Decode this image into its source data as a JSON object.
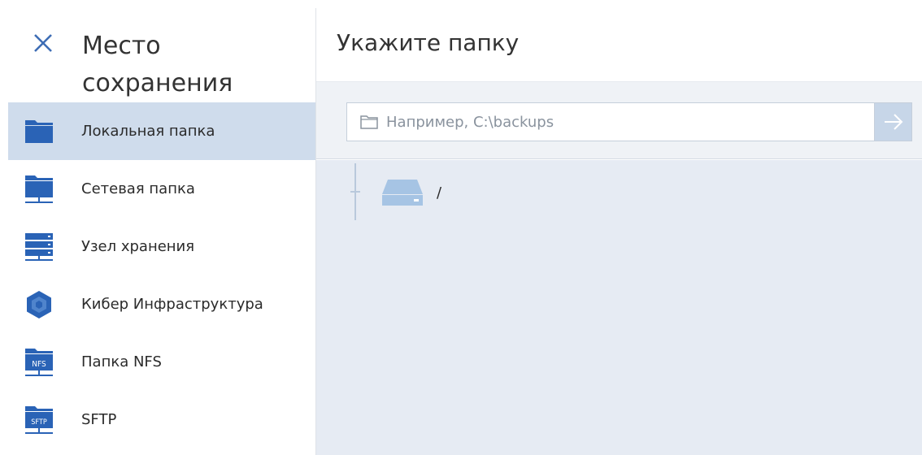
{
  "left_panel": {
    "title": "Место сохранения",
    "close_icon": "close-icon",
    "items": [
      {
        "label": "Локальная папка",
        "icon": "folder-icon",
        "active": true
      },
      {
        "label": "Сетевая папка",
        "icon": "network-folder-icon",
        "active": false
      },
      {
        "label": "Узел хранения",
        "icon": "storage-node-icon",
        "active": false
      },
      {
        "label": "Кибер Инфраструктура",
        "icon": "cyber-infrastructure-icon",
        "active": false
      },
      {
        "label": "Папка NFS",
        "icon": "nfs-folder-icon",
        "badge": "NFS",
        "active": false
      },
      {
        "label": "SFTP",
        "icon": "sftp-folder-icon",
        "badge": "SFTP",
        "active": false
      }
    ]
  },
  "main": {
    "title": "Укажите папку",
    "path_input": {
      "value": "",
      "placeholder": "Например, C:\\backups"
    },
    "go_button_icon": "arrow-right-icon",
    "tree": [
      {
        "label": "/",
        "icon": "drive-icon"
      }
    ]
  },
  "colors": {
    "accent": "#3d6db5",
    "active_item_bg": "#cfdcec",
    "toolbar_bg": "#eff2f6",
    "tree_bg": "#e6ebf3",
    "drive": "#a6c4e4"
  }
}
